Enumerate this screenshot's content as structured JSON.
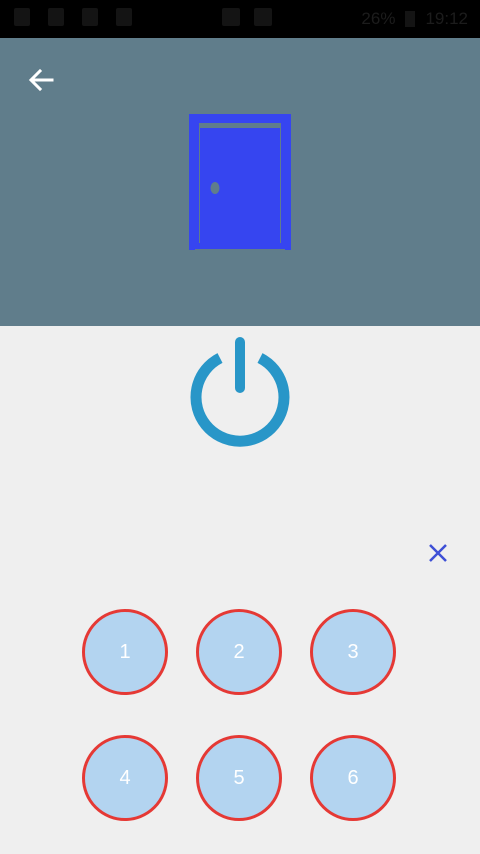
{
  "status_bar": {
    "battery": "26%",
    "time": "19:12"
  },
  "header": {
    "background": "#607d8b",
    "back_icon": "arrow-left-icon",
    "door_icon": "door-icon",
    "door_color": "#3645f0"
  },
  "power": {
    "icon": "power-icon",
    "color": "#2896c8"
  },
  "close": {
    "icon": "close-icon",
    "color": "#3d4fd6"
  },
  "keypad": {
    "keys": [
      "1",
      "2",
      "3",
      "4",
      "5",
      "6"
    ],
    "fill": "#b3d4f0",
    "border": "#e53935"
  }
}
